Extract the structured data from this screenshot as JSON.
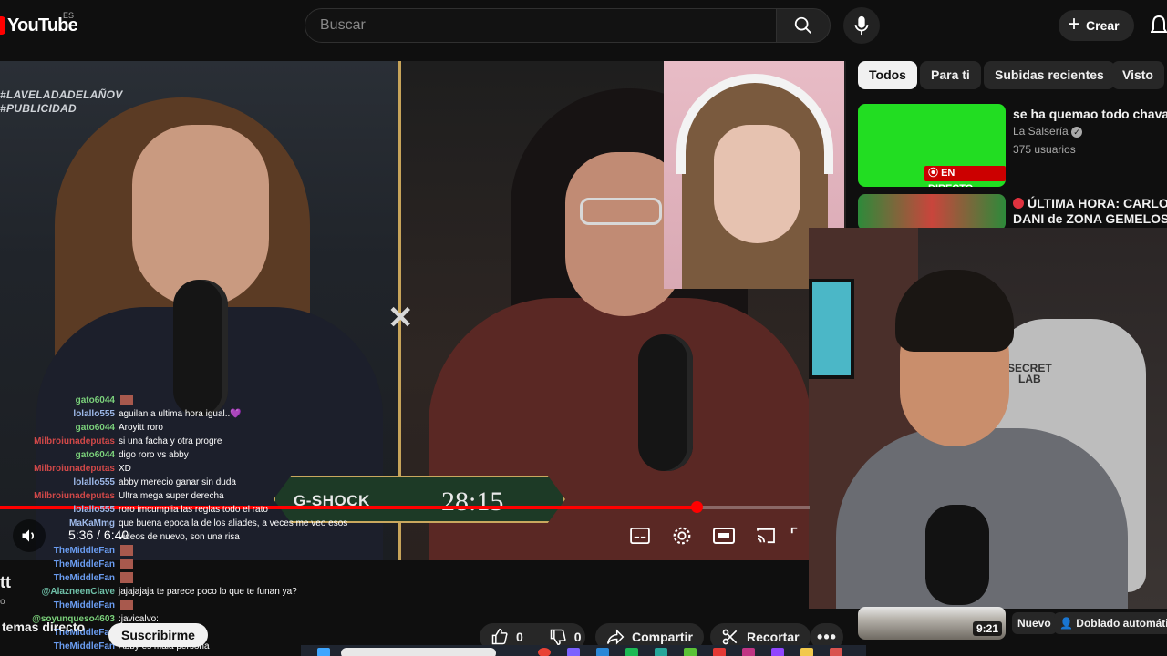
{
  "header": {
    "logo": "YouTube",
    "country": "ES",
    "search_placeholder": "Buscar",
    "create_label": "Crear"
  },
  "video": {
    "overlay_hashtag_1": "#LAVELADADELAÑOV",
    "overlay_hashtag_2": "#PUBLICIDAD",
    "banner_brand": "G-SHOCK",
    "banner_clock": "28:15",
    "chair_brand_1": "SECRET",
    "chair_brand_2": "LAB",
    "progress_fraction": 0.86,
    "time": "5:36 / 6:40"
  },
  "chat": [
    {
      "user": "gato6044",
      "msg": "",
      "color": "#7bd17b",
      "emote": true
    },
    {
      "user": "lolallo555",
      "msg": "aguilan a ultima hora igual..💜",
      "color": "#9db8e8",
      "emote": false
    },
    {
      "user": "gato6044",
      "msg": "Aroyitt roro",
      "color": "#7bd17b",
      "emote": false
    },
    {
      "user": "Milbroiunadeputas",
      "msg": "si una facha y otra progre",
      "color": "#d04848",
      "emote": false
    },
    {
      "user": "gato6044",
      "msg": "digo roro vs abby",
      "color": "#7bd17b",
      "emote": false
    },
    {
      "user": "Milbroiunadeputas",
      "msg": "XD",
      "color": "#d04848",
      "emote": false
    },
    {
      "user": "lolallo555",
      "msg": "abby merecio ganar sin duda",
      "color": "#9db8e8",
      "emote": false
    },
    {
      "user": "Milbroiunadeputas",
      "msg": "Ultra mega super derecha",
      "color": "#d04848",
      "emote": false
    },
    {
      "user": "lolallo555",
      "msg": "roro imcumplia las reglas todo el rato",
      "color": "#9db8e8",
      "emote": false
    },
    {
      "user": "MaKaMmg",
      "msg": "que buena epoca la de los aliades, a veces me veo esos",
      "color": "#9db8e8",
      "emote": false
    },
    {
      "user": "",
      "msg": "videos de nuevo, son una risa",
      "color": "#9db8e8",
      "emote": false
    },
    {
      "user": "TheMiddleFan",
      "msg": "",
      "color": "#6a9cf0",
      "emote": true
    },
    {
      "user": "TheMiddleFan",
      "msg": "",
      "color": "#6a9cf0",
      "emote": true
    },
    {
      "user": "TheMiddleFan",
      "msg": "",
      "color": "#6a9cf0",
      "emote": true
    },
    {
      "user": "@AlazneenClave",
      "msg": "jajajajaja te parece poco lo que te funan ya?",
      "color": "#6fc0a8",
      "emote": false
    },
    {
      "user": "TheMiddleFan",
      "msg": "",
      "color": "#6a9cf0",
      "emote": true
    },
    {
      "user": "@soyunqueso4603",
      "msg": ":javicalvo:",
      "color": "#7bd17b",
      "emote": false
    },
    {
      "user": "TheMiddleFan",
      "msg": "",
      "color": "#6a9cf0",
      "emote": false
    },
    {
      "user": "TheMiddleFan",
      "msg": "Abby es mala persona",
      "color": "#6a9cf0",
      "emote": false
    }
  ],
  "chips": [
    "Todos",
    "Para ti",
    "Subidas recientes",
    "Visto"
  ],
  "recommendations": [
    {
      "title": "se ha quemao todo chavales",
      "channel": "La Salsería",
      "meta": "375 usuarios",
      "badge": "EN DIRECTO"
    },
    {
      "title_line1": "ÚLTIMA HORA: CARLOS y",
      "title_line2": "DANI de ZONA GEMELOS ..."
    }
  ],
  "bottom": {
    "channel_fragment": "tt",
    "channel_sub": "o",
    "live_label": "temas directo",
    "subscribe_label": "Suscribirme",
    "likes": "0",
    "dislikes": "0",
    "share_label": "Compartir",
    "clip_label": "Recortar",
    "duration": "9:21",
    "new_label": "Nuevo",
    "dub_label": "Doblado automática"
  },
  "colors": {
    "accent": "#ff0000",
    "live": "#cc0000",
    "green_thumb": "#22dd22"
  }
}
